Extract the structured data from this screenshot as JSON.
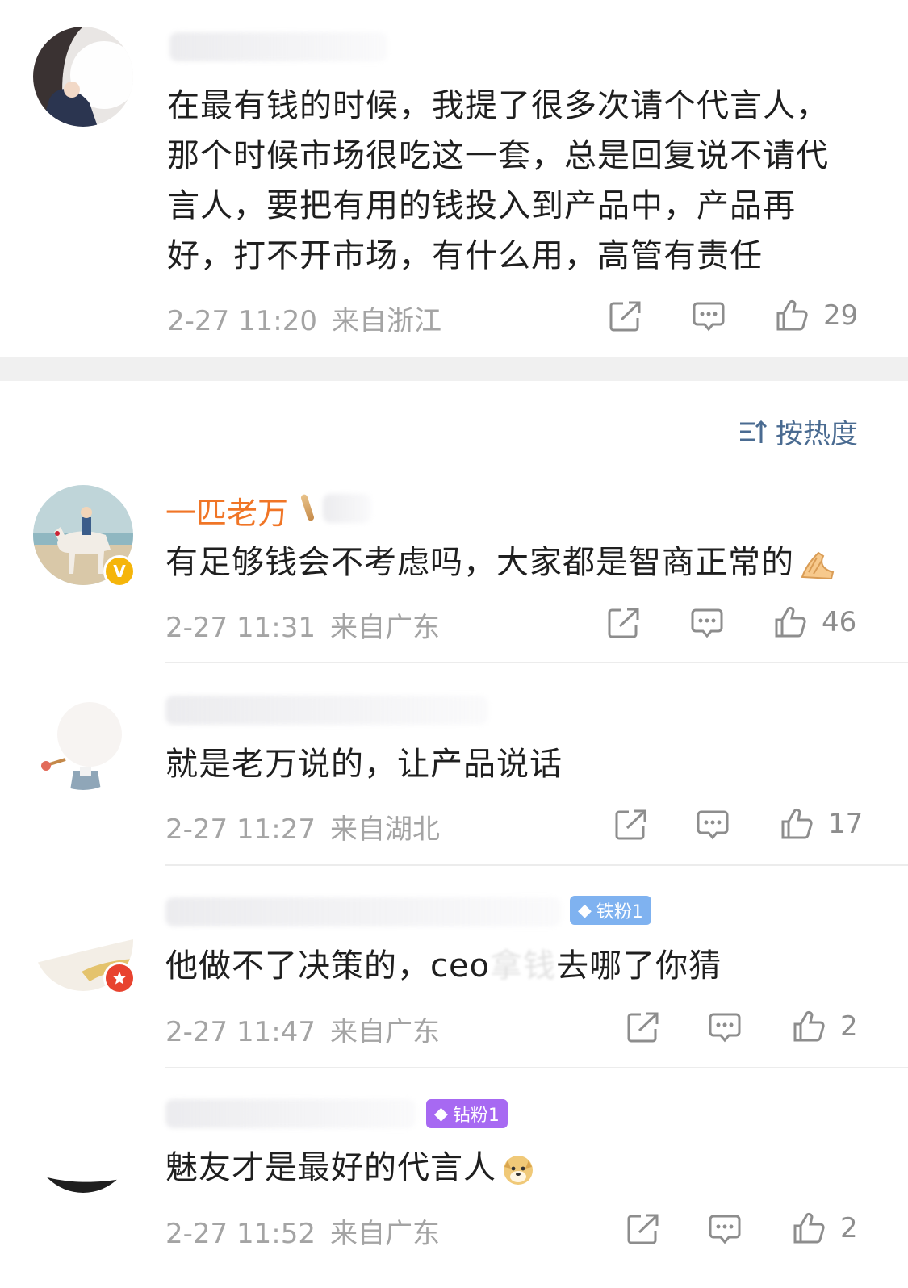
{
  "post": {
    "text_lines": [
      "在最有钱的时候，我提了很多次请个代言人，",
      "那个时候市场很吃这一套，总是回复说不请代",
      "言人，要把有用的钱投入到产品中，产品再",
      "好，打不开市场，有什么用，高管有责任"
    ],
    "time": "2-27 11:20",
    "location": "来自浙江",
    "like_count": "29"
  },
  "sort": {
    "label": "按热度"
  },
  "comments": [
    {
      "username": "一匹老万",
      "text": "有足够钱会不考虑吗，大家都是智商正常的",
      "time": "2-27 11:31",
      "location": "来自广东",
      "like_count": "46",
      "badge": "V"
    },
    {
      "username": "",
      "text": "就是老万说的，让产品说话",
      "time": "2-27 11:27",
      "location": "来自湖北",
      "like_count": "17"
    },
    {
      "username": "",
      "fan_badge": "铁粉1",
      "text_prefix": "他做不了决策的，ceo",
      "text_faded": "拿钱",
      "text_suffix": "去哪了你猜",
      "time": "2-27 11:47",
      "location": "来自广东",
      "like_count": "2"
    },
    {
      "username": "",
      "fan_badge": "钻粉1",
      "text": "魅友才是最好的代言人",
      "time": "2-27 11:52",
      "location": "来自广东",
      "like_count": "2"
    }
  ],
  "colors": {
    "username_accent": "#f07526",
    "sort_link": "#4a6b91",
    "meta_gray": "#a4a4a4",
    "verified_badge": "#f5b50a",
    "red_badge": "#e8432f",
    "iron_fan": "#7fb2f0",
    "diamond_fan": "#a769f2"
  },
  "icons": {
    "share": "share-icon",
    "comment": "comment-icon",
    "like": "like-icon",
    "sort": "sort-icon"
  }
}
